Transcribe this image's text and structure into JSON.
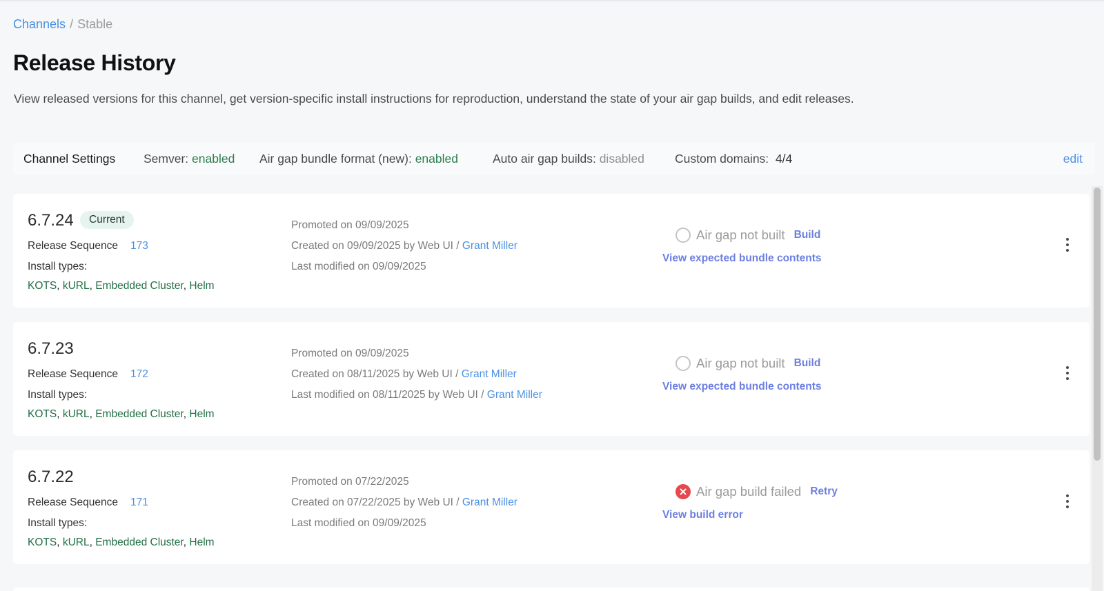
{
  "breadcrumb": {
    "parent": "Channels",
    "separator": "/",
    "current": "Stable"
  },
  "page": {
    "title": "Release History",
    "description": "View released versions for this channel, get version-specific install instructions for reproduction, understand the state of your air gap builds, and edit releases."
  },
  "channel_settings": {
    "title": "Channel Settings",
    "semver_label": "Semver:",
    "semver_value": "enabled",
    "bundle_label": "Air gap bundle format (new):",
    "bundle_value": "enabled",
    "auto_label": "Auto air gap builds:",
    "auto_value": "disabled",
    "domains_label": "Custom domains:",
    "domains_value": "4/4",
    "edit_label": "edit"
  },
  "releases": [
    {
      "version": "6.7.24",
      "badge": "Current",
      "sequence_label": "Release Sequence",
      "sequence": "173",
      "install_label": "Install types:",
      "install_types": [
        "KOTS",
        "kURL",
        "Embedded Cluster",
        "Helm"
      ],
      "promoted": "Promoted on 09/09/2025",
      "created_prefix": "Created on 09/09/2025 by Web UI / ",
      "created_author": "Grant Miller",
      "modified_prefix": "Last modified on 09/09/2025",
      "modified_author": "",
      "status_text": "Air gap not built",
      "status_action": "Build",
      "bundle_link": "View expected bundle contents",
      "status_icon": "circle-outline-icon"
    },
    {
      "version": "6.7.23",
      "badge": "",
      "sequence_label": "Release Sequence",
      "sequence": "172",
      "install_label": "Install types:",
      "install_types": [
        "KOTS",
        "kURL",
        "Embedded Cluster",
        "Helm"
      ],
      "promoted": "Promoted on 09/09/2025",
      "created_prefix": "Created on 08/11/2025 by Web UI / ",
      "created_author": "Grant Miller",
      "modified_prefix": "Last modified on 08/11/2025 by Web UI / ",
      "modified_author": "Grant Miller",
      "status_text": "Air gap not built",
      "status_action": "Build",
      "bundle_link": "View expected bundle contents",
      "status_icon": "circle-outline-icon"
    },
    {
      "version": "6.7.22",
      "badge": "",
      "sequence_label": "Release Sequence",
      "sequence": "171",
      "install_label": "Install types:",
      "install_types": [
        "KOTS",
        "kURL",
        "Embedded Cluster",
        "Helm"
      ],
      "promoted": "Promoted on 07/22/2025",
      "created_prefix": "Created on 07/22/2025 by Web UI / ",
      "created_author": "Grant Miller",
      "modified_prefix": "Last modified on 09/09/2025",
      "modified_author": "",
      "status_text": "Air gap build failed",
      "status_action": "Retry",
      "bundle_link": "View build error",
      "status_icon": "error-x-icon"
    }
  ],
  "colors": {
    "link_blue": "#4a90e2",
    "action_purple": "#6d7fe0",
    "enabled_green": "#2e7d4f",
    "install_green": "#1f6e43",
    "error_red": "#e5484d",
    "badge_bg": "#e5f4ee"
  }
}
